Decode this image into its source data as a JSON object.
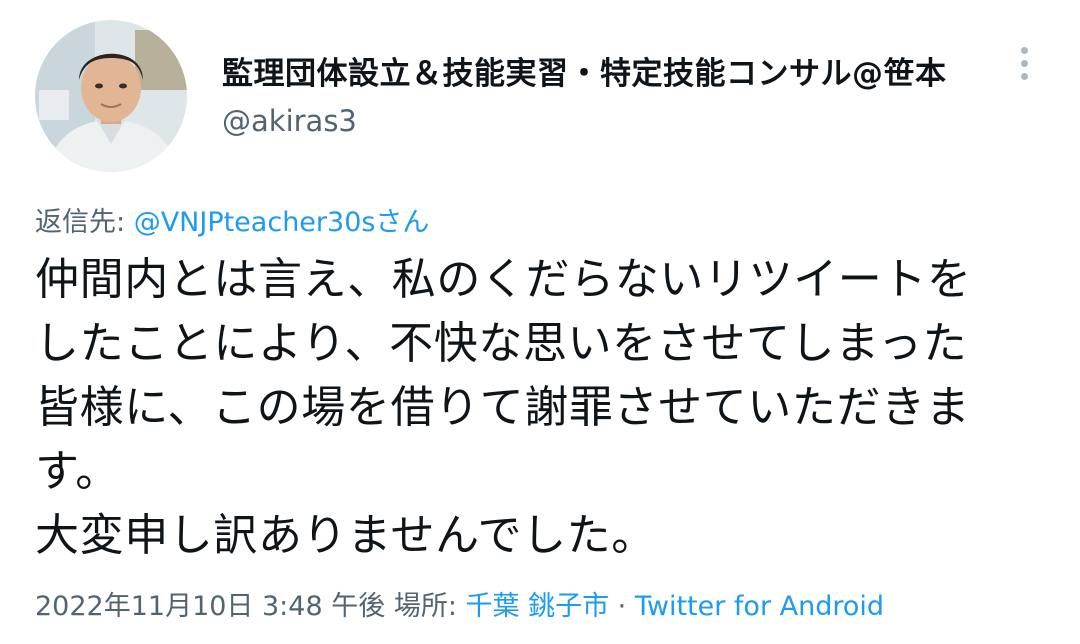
{
  "author": {
    "display_name": "監理団体設立＆技能実習・特定技能コンサル@笹本",
    "handle": "@akiras3",
    "avatar_icon": "user-avatar-photo"
  },
  "reply": {
    "prefix": "返信先: ",
    "mention": "@VNJPteacher30sさん"
  },
  "tweet": {
    "lines": [
      "仲間内とは言え、私のくだらないリツイートを",
      "したことにより、不快な思いをさせてしまった",
      "皆様に、この場を借りて謝罪させていただきま",
      "す。",
      "大変申し訳ありませんでした。"
    ]
  },
  "meta": {
    "datetime": "2022年11月10日 3:48 午後",
    "location_prefix": " 場所: ",
    "location": "千葉 銚子市",
    "separator": " · ",
    "source": "Twitter for Android"
  },
  "menu_icon": "more-vertical-icon",
  "colors": {
    "link": "#1d9bf0",
    "secondary_text": "#536471",
    "primary_text": "#0f1419"
  }
}
